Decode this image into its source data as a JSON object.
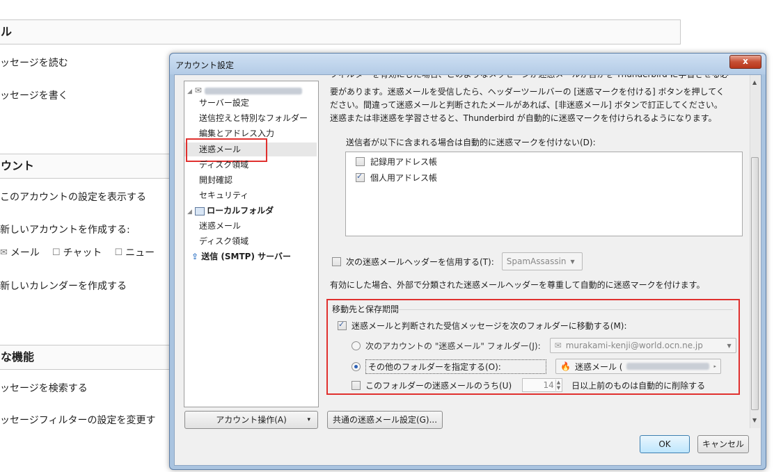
{
  "background": {
    "section1_title": "ル",
    "read_messages": "ッセージを読む",
    "write_messages": "ッセージを書く",
    "section2_title": "ウント",
    "show_account_settings": "このアカウントの設定を表示する",
    "create_account": "新しいアカウントを作成する:",
    "create_mail": "メール",
    "create_chat": "チャット",
    "create_news": "ニュー",
    "create_calendar": "新しいカレンダーを作成する",
    "section3_title": "な機能",
    "search_messages": "ッセージを検索する",
    "filter_settings": "ッセージフィルターの設定を変更す"
  },
  "dialog": {
    "title": "アカウント設定",
    "close_glyph": "x",
    "tree": {
      "account_items": [
        "サーバー設定",
        "送信控えと特別なフォルダー",
        "編集とアドレス入力",
        "迷惑メール",
        "ディスク領域",
        "開封確認",
        "セキュリティ"
      ],
      "local_folder": "ローカルフォルダ",
      "local_items": [
        "迷惑メール",
        "ディスク領域"
      ],
      "smtp": "送信 (SMTP) サーバー",
      "selected": "迷惑メール"
    },
    "account_actions_button": "アカウント操作(A)",
    "account_actions_arrow": "▾",
    "intro_line0": "フィルターを有効にした場合、このようなメッセージが迷惑メールか否かを Thunderbird に学習させる必",
    "intro_line1": "要があります。迷惑メールを受信したら、ヘッダーツールバーの [迷惑マークを付ける] ボタンを押してく",
    "intro_line2": "ださい。間違って迷惑メールと判断されたメールがあれば、[非迷惑メール] ボタンで訂正してください。",
    "intro_line3": "迷惑または非迷惑を学習させると、Thunderbird が自動的に迷惑マークを付けられるようになります。",
    "whitelist_label": "送信者が以下に含まれる場合は自動的に迷惑マークを付けない(D):",
    "address_books": [
      {
        "label": "記録用アドレス帳",
        "checked": false
      },
      {
        "label": "個人用アドレス帳",
        "checked": true
      }
    ],
    "trust_header_label": "次の迷惑メールヘッダーを信用する(T):",
    "trust_header_value": "SpamAssassin",
    "trust_header_note": "有効にした場合、外部で分類された迷惑メールヘッダーを尊重して自動的に迷惑マークを付けます。",
    "group_title": "移動先と保存期間",
    "move_label": "迷惑メールと判断された受信メッセージを次のフォルダーに移動する(M):",
    "radio_account_label": "次のアカウントの \"迷惑メール\" フォルダー(J):",
    "radio_account_value": "murakami-kenji@world.ocn.ne.jp",
    "radio_other_label": "その他のフォルダーを指定する(O):",
    "radio_other_value": "迷惑メール (",
    "delete_label": "このフォルダーの迷惑メールのうち(U)",
    "delete_days": "14",
    "delete_suffix": "日以上前のものは自動的に削除する",
    "global_settings_button": "共通の迷惑メール設定(G)...",
    "ok_button": "OK",
    "cancel_button": "キャンセル",
    "colors": {
      "highlight_red": "#e0302e",
      "title_bar": "#b3cbe6",
      "ok_button": "#bee6fd"
    }
  }
}
